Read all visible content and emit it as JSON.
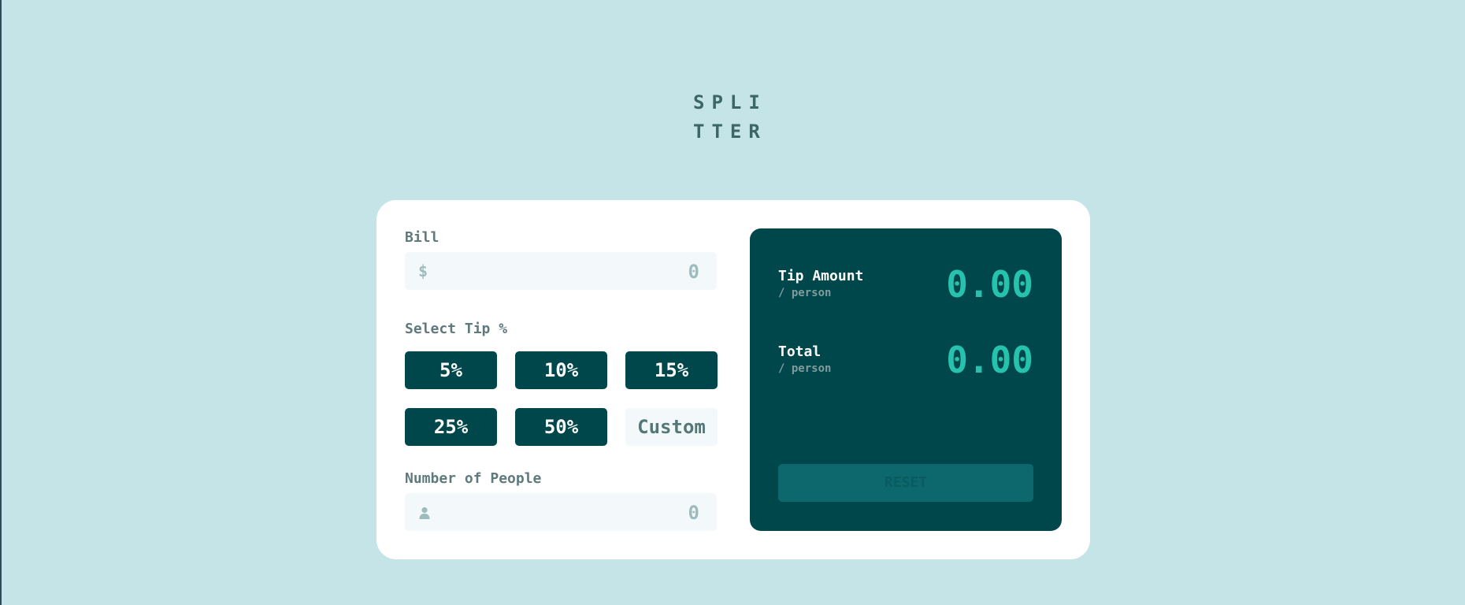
{
  "logo": {
    "text": "SPLITTER"
  },
  "bill": {
    "label": "Bill",
    "currency_symbol": "$",
    "value": "0"
  },
  "tip": {
    "label": "Select Tip %",
    "options": [
      "5%",
      "10%",
      "15%",
      "25%",
      "50%"
    ],
    "custom_placeholder": "Custom"
  },
  "people": {
    "label": "Number of People",
    "value": "0",
    "icon": "person-icon"
  },
  "results": {
    "tip_amount_label": "Tip Amount",
    "tip_amount_sub": "/ person",
    "tip_amount_value": "0.00",
    "total_label": "Total",
    "total_sub": "/ person",
    "total_value": "0.00",
    "reset_label": "RESET"
  },
  "colors": {
    "background": "#c5e4e7",
    "panel": "#00474b",
    "accent": "#26c2ad",
    "reset_disabled": "#0d686d"
  }
}
